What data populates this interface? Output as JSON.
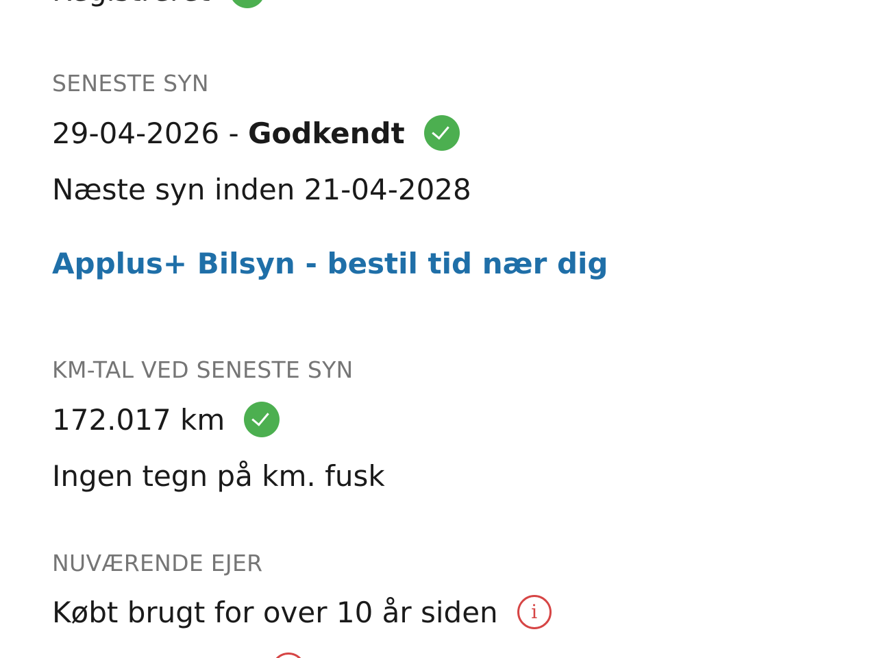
{
  "registered": {
    "label": "Registreret"
  },
  "inspection": {
    "label": "SENESTE SYN",
    "date": "29-04-2026",
    "separator": " - ",
    "status": "Godkendt",
    "status_icon": "check-circle-icon",
    "next": "Næste syn inden 21-04-2028",
    "booking_link": "Applus+ Bilsyn - bestil tid nær dig"
  },
  "mileage": {
    "label": "KM-TAL VED SENESTE SYN",
    "value": "172.017 km",
    "status_icon": "check-circle-icon",
    "note": "Ingen tegn på km. fusk"
  },
  "owner": {
    "label": "NUVÆRENDE EJER",
    "value": "Købt brugt for over 10 år siden",
    "info_icon": "info-icon",
    "info_glyph": "i"
  },
  "colors": {
    "label_gray": "#757575",
    "link_blue": "#1f6fa8",
    "success_green": "#4caf50",
    "warning_red": "#d64545"
  }
}
